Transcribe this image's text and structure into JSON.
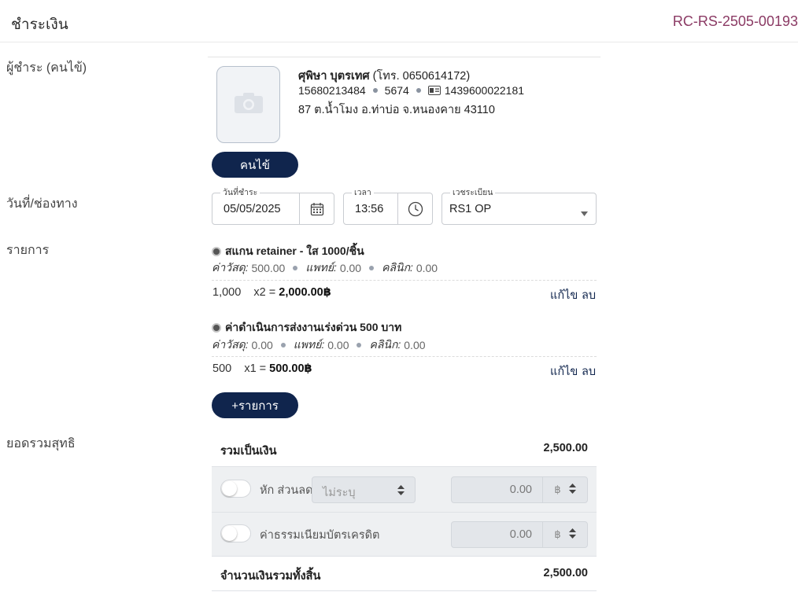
{
  "header": {
    "title": "ชำระเงิน",
    "receipt_no": "RC-RS-2505-00193"
  },
  "labels": {
    "payer": "ผู้ชำระ (คนไข้)",
    "date_channel": "วันที่/ช่องทาง",
    "items": "รายการ",
    "net_total": "ยอดรวมสุทธิ"
  },
  "payer": {
    "name": "ศุพิษา บุตรเทศ",
    "phone": "(โทร. 0650614172)",
    "hn": "15680213484",
    "code": "5674",
    "id_card": "1439600022181",
    "address": "87 ต.น้ำโมง อ.ท่าบ่อ จ.หนองคาย 43110",
    "patient_button": "คนไข้"
  },
  "fields": {
    "date": {
      "label": "วันที่ชำระ",
      "value": "05/05/2025"
    },
    "time": {
      "label": "เวลา",
      "value": "13:56"
    },
    "register": {
      "label": "เวชระเบียน",
      "value": "RS1 OP"
    }
  },
  "items": [
    {
      "title": "สแกน retainer - ใส 1000/ชิ้น",
      "material_label": "ค่าวัสดุ:",
      "material": "500.00",
      "doctor_label": "แพทย์:",
      "doctor": "0.00",
      "clinic_label": "คลินิก:",
      "clinic": "0.00",
      "price": "1,000",
      "qty": "x2 =",
      "total": "2,000.00฿",
      "edit": "แก้ไข",
      "delete": "ลบ"
    },
    {
      "title": "ค่าดำเนินการส่งงานเร่งด่วน 500 บาท",
      "material_label": "ค่าวัสดุ:",
      "material": "0.00",
      "doctor_label": "แพทย์:",
      "doctor": "0.00",
      "clinic_label": "คลินิก:",
      "clinic": "0.00",
      "price": "500",
      "qty": "x1 =",
      "total": "500.00฿",
      "edit": "แก้ไข",
      "delete": "ลบ"
    }
  ],
  "add_item_button": "+รายการ",
  "totals": {
    "subtotal_label": "รวมเป็นเงิน",
    "subtotal": "2,500.00",
    "discount_label": "หัก ส่วนลด",
    "discount_select": "ไม่ระบุ",
    "discount_amount": "0.00",
    "card_fee_label": "ค่าธรรมเนียมบัตรเครดิต",
    "card_fee_amount": "0.00",
    "currency": "฿",
    "grand_label": "จำนวนเงินรวมทั้งสิ้น",
    "grand_total": "2,500.00"
  },
  "icons": {
    "photo": "camera-icon",
    "calendar": "calendar-icon",
    "clock": "clock-icon",
    "id_card": "id-card-icon",
    "dropdown": "caret-down-icon",
    "spinner": "updown-icon"
  },
  "colors": {
    "navy": "#10254d",
    "receipt": "#8b3a64"
  }
}
